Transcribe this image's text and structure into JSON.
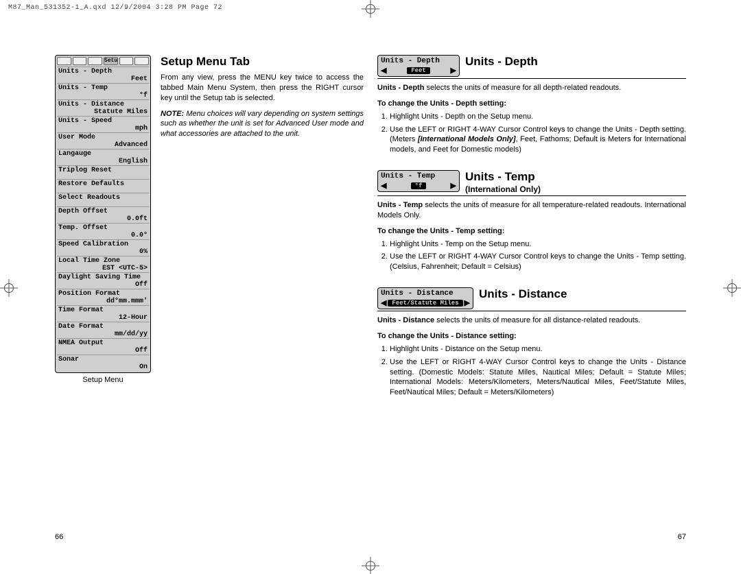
{
  "print_header": "M87_Man_531352-1_A.qxd  12/9/2004  3:28 PM  Page 72",
  "page_numbers": {
    "left": "66",
    "right": "67"
  },
  "left": {
    "heading": "Setup Menu Tab",
    "body": "From any view, press the MENU key twice to access the tabbed Main Menu System, then press the RIGHT cursor key until the Setup tab is selected.",
    "note_label": "NOTE:",
    "note_body": "Menu choices will vary depending on system settings such as whether the unit is set for Advanced User mode and what accessories are attached to the unit.",
    "lcd_caption": "Setup Menu",
    "lcd_tab_selected": "Setup",
    "lcd_rows": [
      {
        "k": "Units - Depth",
        "v": "Feet"
      },
      {
        "k": "Units - Temp",
        "v": "°f"
      },
      {
        "k": "Units - Distance",
        "v": "Statute Miles"
      },
      {
        "k": "Units - Speed",
        "v": "mph"
      },
      {
        "k": "User Mode",
        "v": "Advanced"
      },
      {
        "k": "Langauge",
        "v": "English"
      },
      {
        "k": "Triplog Reset",
        "v": ""
      },
      {
        "k": "Restore Defaults",
        "v": ""
      },
      {
        "k": "Select Readouts",
        "v": ""
      },
      {
        "k": "Depth Offset",
        "v": "0.0ft"
      },
      {
        "k": "Temp. Offset",
        "v": "0.0°"
      },
      {
        "k": "Speed Calibration",
        "v": "0%"
      },
      {
        "k": "Local Time Zone",
        "v": "EST <UTC-5>"
      },
      {
        "k": "Daylight Saving Time",
        "v": "Off"
      },
      {
        "k": "Position Format",
        "v": "dd°mm.mmm'"
      },
      {
        "k": "Time Format",
        "v": "12-Hour"
      },
      {
        "k": "Date Format",
        "v": "mm/dd/yy"
      },
      {
        "k": "NMEA Output",
        "v": "Off"
      },
      {
        "k": "Sonar",
        "v": "On"
      }
    ]
  },
  "right": {
    "depth": {
      "widget_title": "Units - Depth",
      "widget_value": "Feet",
      "heading": "Units - Depth",
      "lead_bold": "Units - Depth",
      "lead_rest": " selects the units of measure for all depth-related readouts.",
      "howto": "To change the Units - Depth setting:",
      "step1": "Highlight Units - Depth on the Setup menu.",
      "step2a": "Use the LEFT or RIGHT 4-WAY Cursor Control keys to change the Units - Depth setting. (Meters ",
      "step2b": "[International Models Only]",
      "step2c": ", Feet, Fathoms; Default is Meters for International models, and Feet for Domestic models)"
    },
    "temp": {
      "widget_title": "Units - Temp",
      "widget_value": "°f",
      "heading": "Units - Temp",
      "subheading": "(International Only)",
      "lead_bold": "Units - Temp",
      "lead_rest": " selects the units of measure for all temperature-related readouts.  International Models Only.",
      "howto": "To change the Units - Temp setting:",
      "step1": "Highlight Units - Temp on the Setup menu.",
      "step2": "Use the LEFT or RIGHT 4-WAY Cursor Control keys to change the Units - Temp setting. (Celsius, Fahrenheit; Default = Celsius)"
    },
    "distance": {
      "widget_title": "Units - Distance",
      "widget_value": "Feet/Statute Miles",
      "heading": "Units - Distance",
      "lead_bold": "Units - Distance",
      "lead_rest": " selects the units of measure for all distance-related readouts.",
      "howto": "To change the Units - Distance setting:",
      "step1": "Highlight Units - Distance on the Setup menu.",
      "step2": "Use the LEFT or RIGHT 4-WAY Cursor Control keys to change the Units - Distance setting. (Domestic Models: Statute Miles, Nautical Miles; Default = Statute Miles; International Models: Meters/Kilometers, Meters/Nautical Miles, Feet/Statute Miles, Feet/Nautical Miles; Default = Meters/Kilometers)"
    }
  }
}
